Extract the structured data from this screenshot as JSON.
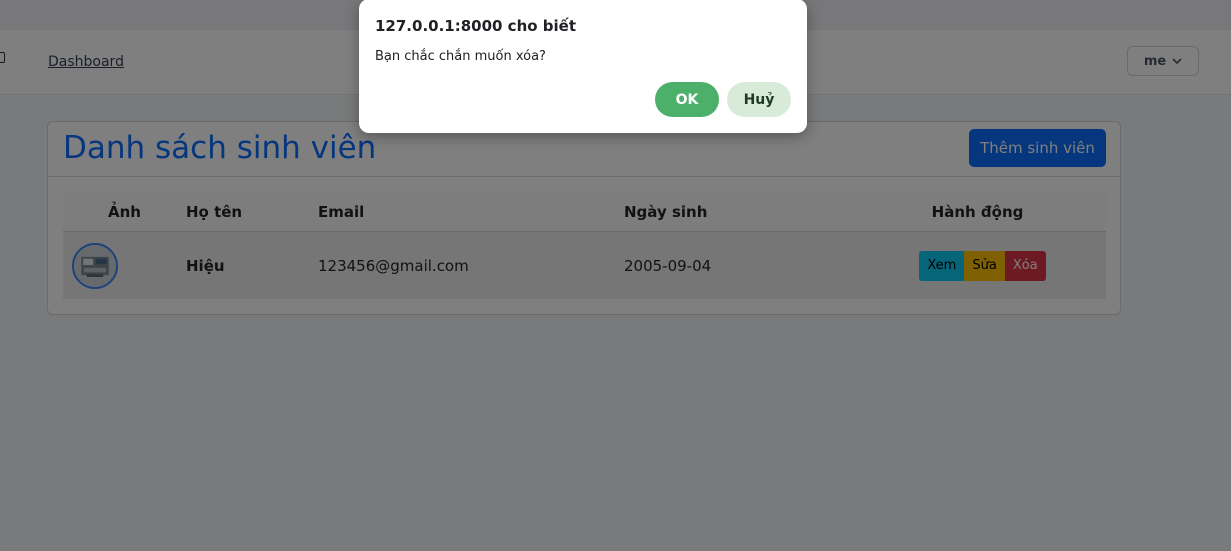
{
  "nav": {
    "dashboard_label": "Dashboard",
    "user_label": "me"
  },
  "card": {
    "title": "Danh sách sinh viên",
    "add_label": "Thêm sinh viên"
  },
  "table": {
    "headers": {
      "photo": "Ảnh",
      "name": "Họ tên",
      "email": "Email",
      "dob": "Ngày sinh",
      "actions": "Hành động"
    },
    "rows": [
      {
        "name": "Hiệu",
        "email": "123456@gmail.com",
        "dob": "2005-09-04"
      }
    ],
    "action_labels": {
      "view": "Xem",
      "edit": "Sửa",
      "delete": "Xóa"
    }
  },
  "dialog": {
    "title": "127.0.0.1:8000 cho biết",
    "message": "Bạn chắc chắn muốn xóa?",
    "ok_label": "OK",
    "cancel_label": "Huỷ"
  },
  "colors": {
    "primary": "#0d6efd",
    "info": "#0dcaf0",
    "warning": "#ffc107",
    "danger": "#dc3545",
    "dialog_ok": "#4caf6a",
    "dialog_cancel": "#d8ebd9"
  }
}
